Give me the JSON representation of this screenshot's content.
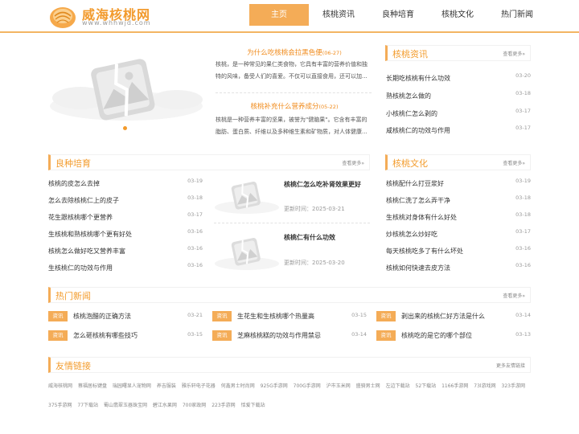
{
  "site": {
    "title": "威海核桃网",
    "domain": "www.whhwjd.com"
  },
  "nav": [
    {
      "label": "主页",
      "active": true
    },
    {
      "label": "核桃资讯",
      "active": false
    },
    {
      "label": "良种培育",
      "active": false
    },
    {
      "label": "核桃文化",
      "active": false
    },
    {
      "label": "热门新闻",
      "active": false
    }
  ],
  "featured": [
    {
      "title": "为什么吃核桃会拉黑色便",
      "date": "(06-27)",
      "desc": "核桃，是一种常见的果仁类食物，它具有丰富的营养价值和独特的风味，备受人们的喜爱。不仅可以直接食用，还可以加..."
    },
    {
      "title": "核桃补充什么营养成分",
      "date": "(05-22)",
      "desc": "核桃是一种营养丰富的坚果，被誉为\"健脑果\"。它含有丰富的脂肪、蛋白质、纤维以及多种维生素和矿物质，对人体健康..."
    }
  ],
  "news": {
    "title": "核桃资讯",
    "more": "查看更多»",
    "items": [
      {
        "text": "长期吃核桃有什么功效",
        "date": "03-20"
      },
      {
        "text": "熟核桃怎么做的",
        "date": "03-18"
      },
      {
        "text": "小核桃仁怎么剥的",
        "date": "03-17"
      },
      {
        "text": "咸核桃仁的功效与作用",
        "date": "03-17"
      }
    ]
  },
  "breeding": {
    "title": "良种培育",
    "more": "查看更多»",
    "items": [
      {
        "text": "核桃的皮怎么去掉",
        "date": "03-19"
      },
      {
        "text": "怎么去除核桃仁上的皮子",
        "date": "03-18"
      },
      {
        "text": "花生跟核桃哪个更营养",
        "date": "03-17"
      },
      {
        "text": "生核桃和熟核桃哪个更有好处",
        "date": "03-16"
      },
      {
        "text": "核桃怎么做好吃又营养丰富",
        "date": "03-16"
      },
      {
        "text": "生核桃仁的功效与作用",
        "date": "03-16"
      }
    ],
    "features": [
      {
        "title": "核桃仁怎么吃补肾效果更好",
        "date_label": "更新时间：",
        "date": "2025-03-21"
      },
      {
        "title": "核桃仁有什么功效",
        "date_label": "更新时间：",
        "date": "2025-03-20"
      }
    ]
  },
  "culture": {
    "title": "核桃文化",
    "more": "查看更多»",
    "items": [
      {
        "text": "核桃配什么打豆浆好",
        "date": "03-19"
      },
      {
        "text": "核桃仁洗了怎么弄干净",
        "date": "03-18"
      },
      {
        "text": "生核桃对身体有什么好处",
        "date": "03-18"
      },
      {
        "text": "炒核桃怎么炒好吃",
        "date": "03-17"
      },
      {
        "text": "每天核桃吃多了有什么坏处",
        "date": "03-16"
      },
      {
        "text": "核桃如何快速去皮方法",
        "date": "03-16"
      }
    ]
  },
  "hot": {
    "title": "热门新闻",
    "more": "查看更多»",
    "tag": "资讯",
    "items": [
      {
        "text": "核桃泡醋的正确方法",
        "date": "03-21"
      },
      {
        "text": "生花生和生核桃哪个热量高",
        "date": "03-15"
      },
      {
        "text": "剥出来的核桃仁好方法是什么",
        "date": "03-14"
      },
      {
        "text": "怎么砸核桃有哪些技巧",
        "date": "03-15"
      },
      {
        "text": "芝麻核桃糕的功效与作用禁忌",
        "date": "03-14"
      },
      {
        "text": "核桃吃的是它的哪个部位",
        "date": "03-13"
      }
    ]
  },
  "links": {
    "title": "友情链接",
    "more": "更多友情链接",
    "items": [
      "威海核桃网",
      "蔡福居标键盘",
      "瑞园曙显人宠物网",
      "养吉服装",
      "雅乐轩电子花器",
      "何鑫男士时尚网",
      "925G手游网",
      "700G手游网",
      "沪市玉米网",
      "盛骑男士网",
      "左边下载站",
      "52下载站",
      "1166手游网",
      "73l游戏网",
      "323手游网",
      "375手游网",
      "77下载站",
      "蜀山翡翠玉器珠宝网",
      "碧江水果网",
      "700家政网",
      "223手游网",
      "恬爱下载站"
    ]
  },
  "colors": {
    "accent": "#f4ac57",
    "title": "#f39c2d"
  }
}
